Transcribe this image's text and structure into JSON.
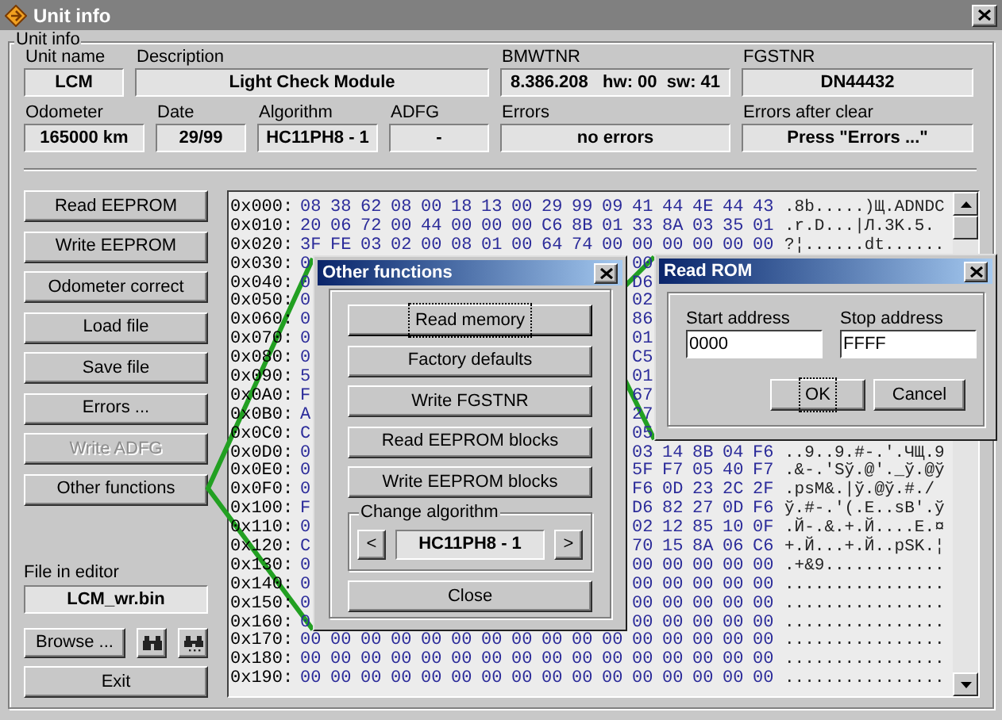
{
  "window": {
    "title": "Unit info"
  },
  "unit_info": {
    "title": "Unit info",
    "row_1": [
      {
        "label": "Unit name",
        "value": "LCM"
      },
      {
        "label": "Description",
        "value": "Light Check Module"
      },
      {
        "label": "BMWTNR",
        "value": "8.386.208   hw: 00  sw: 41"
      },
      {
        "label": "FGSTNR",
        "value": "DN44432"
      }
    ],
    "row_2": [
      {
        "label": "Odometer",
        "value": "165000 km"
      },
      {
        "label": "Date",
        "value": "29/99"
      },
      {
        "label": "Algorithm",
        "value": "HC11PH8 - 1"
      },
      {
        "label": "ADFG",
        "value": "-"
      },
      {
        "label": "Errors",
        "value": "no errors"
      },
      {
        "label": "Errors after clear",
        "value": "Press \"Errors ...\""
      }
    ]
  },
  "buttons": [
    {
      "label": "Read EEPROM",
      "disabled": false
    },
    {
      "label": "Write EEPROM",
      "disabled": false
    },
    {
      "label": "Odometer correct",
      "disabled": false
    },
    {
      "label": "Load file",
      "disabled": false
    },
    {
      "label": "Save file",
      "disabled": false
    },
    {
      "label": "Errors ...",
      "disabled": false
    },
    {
      "label": "Write ADFG",
      "disabled": true
    },
    {
      "label": "Other functions",
      "disabled": false
    }
  ],
  "file_in_editor": {
    "label": "File in editor",
    "value": "LCM_wr.bin"
  },
  "browse_button": "Browse ...",
  "exit_button": "Exit",
  "hex_view": {
    "rows": [
      {
        "kind": "full",
        "address": "0x000:",
        "bytes": [
          "08",
          "38",
          "62",
          "08",
          "00",
          "18",
          "13",
          "00",
          "29",
          "99",
          "09",
          "41",
          "44",
          "4E",
          "44",
          "43"
        ],
        "ascii": ".8b.....)Щ.ADNDC"
      },
      {
        "kind": "full",
        "address": "0x010:",
        "bytes": [
          "20",
          "06",
          "72",
          "00",
          "44",
          "00",
          "00",
          "00",
          "C6",
          "8B",
          "01",
          "33",
          "8A",
          "03",
          "35",
          "01"
        ],
        "ascii": ".r.D...|Л.3K.5."
      },
      {
        "kind": "full",
        "address": "0x020:",
        "bytes": [
          "3F",
          "FE",
          "03",
          "02",
          "00",
          "08",
          "01",
          "00",
          "64",
          "74",
          "00",
          "00",
          "00",
          "00",
          "00",
          "00"
        ],
        "ascii": "?¦......dt......"
      },
      {
        "kind": "covered",
        "address": "0x030:",
        "first": "0",
        "tail": [
          "00"
        ]
      },
      {
        "kind": "covered",
        "address": "0x040:",
        "first": "0",
        "tail": [
          "D6"
        ]
      },
      {
        "kind": "covered",
        "address": "0x050:",
        "first": "0",
        "tail": [
          "02"
        ]
      },
      {
        "kind": "covered",
        "address": "0x060:",
        "first": "0",
        "tail": [
          "86"
        ]
      },
      {
        "kind": "covered",
        "address": "0x070:",
        "first": "0",
        "tail": [
          "01"
        ]
      },
      {
        "kind": "covered",
        "address": "0x080:",
        "first": "0",
        "tail": [
          "C5"
        ]
      },
      {
        "kind": "covered",
        "address": "0x090:",
        "first": "5",
        "tail": [
          "01"
        ]
      },
      {
        "kind": "covered",
        "address": "0x0A0:",
        "first": "F",
        "tail": [
          "67"
        ]
      },
      {
        "kind": "covered",
        "address": "0x0B0:",
        "first": "A",
        "tail": [
          "27"
        ]
      },
      {
        "kind": "covered",
        "address": "0x0C0:",
        "first": "C",
        "tail": [
          "05"
        ]
      },
      {
        "kind": "covered",
        "address": "0x0D0:",
        "first": "0",
        "tail": [
          "03",
          "14",
          "8B",
          "04",
          "F6"
        ],
        "ascii": "..9..9.#-.'.ЧЩ.9"
      },
      {
        "kind": "covered",
        "address": "0x0E0:",
        "first": "0",
        "tail": [
          "5F",
          "F7",
          "05",
          "40",
          "F7"
        ],
        "ascii": ".&-.'Sў.@'._ў.@ў"
      },
      {
        "kind": "covered",
        "address": "0x0F0:",
        "first": "0",
        "tail": [
          "F6",
          "0D",
          "23",
          "2C",
          "2F"
        ],
        "ascii": ".psM&.|ў.@ў.#./"
      },
      {
        "kind": "covered",
        "address": "0x100:",
        "first": "F",
        "tail": [
          "D6",
          "82",
          "27",
          "0D",
          "F6"
        ],
        "ascii": "ў.#-.'(.E..sB'.ў"
      },
      {
        "kind": "covered",
        "address": "0x110:",
        "first": "0",
        "tail": [
          "02",
          "12",
          "85",
          "10",
          "0F"
        ],
        "ascii": ".Й-.&.+.Й....E.¤"
      },
      {
        "kind": "covered",
        "address": "0x120:",
        "first": "C",
        "tail": [
          "70",
          "15",
          "8A",
          "06",
          "C6"
        ],
        "ascii": "+.Й...+.Й..pSK.¦"
      },
      {
        "kind": "covered",
        "address": "0x130:",
        "first": "0",
        "tail": [
          "00",
          "00",
          "00",
          "00",
          "00"
        ],
        "ascii": ".+&9............"
      },
      {
        "kind": "covered",
        "address": "0x140:",
        "first": "0",
        "tail": [
          "00",
          "00",
          "00",
          "00",
          "00"
        ],
        "ascii": "................"
      },
      {
        "kind": "covered",
        "address": "0x150:",
        "first": "0",
        "tail": [
          "00",
          "00",
          "00",
          "00",
          "00"
        ],
        "ascii": "................"
      },
      {
        "kind": "covered",
        "address": "0x160:",
        "first": "0",
        "tail": [
          "00",
          "00",
          "00",
          "00",
          "00"
        ],
        "ascii": "................"
      },
      {
        "kind": "full",
        "address": "0x170:",
        "bytes": [
          "00",
          "00",
          "00",
          "00",
          "00",
          "00",
          "00",
          "00",
          "00",
          "00",
          "00",
          "00",
          "00",
          "00",
          "00",
          "00"
        ],
        "ascii": "................"
      },
      {
        "kind": "full",
        "address": "0x180:",
        "bytes": [
          "00",
          "00",
          "00",
          "00",
          "00",
          "00",
          "00",
          "00",
          "00",
          "00",
          "00",
          "00",
          "00",
          "00",
          "00",
          "00"
        ],
        "ascii": "................"
      },
      {
        "kind": "full",
        "address": "0x190:",
        "bytes": [
          "00",
          "00",
          "00",
          "00",
          "00",
          "00",
          "00",
          "00",
          "00",
          "00",
          "00",
          "00",
          "00",
          "00",
          "00",
          "00"
        ],
        "ascii": "................"
      }
    ]
  },
  "other_functions": {
    "title": "Other functions",
    "buttons": [
      {
        "label": "Read memory",
        "focused": true
      },
      {
        "label": "Factory defaults",
        "focused": false
      },
      {
        "label": "Write FGSTNR",
        "focused": false
      },
      {
        "label": "Read EEPROM blocks",
        "focused": false
      },
      {
        "label": "Write EEPROM blocks",
        "focused": false
      }
    ],
    "change_algorithm": {
      "label": "Change algorithm",
      "prev": "<",
      "value": "HC11PH8 - 1",
      "next": ">"
    },
    "close_button": "Close"
  },
  "read_rom": {
    "title": "Read ROM",
    "start_address": {
      "label": "Start address",
      "value": "0000"
    },
    "stop_address": {
      "label": "Stop address",
      "value": "FFFF"
    },
    "buttons": [
      {
        "label": "OK",
        "focused": true
      },
      {
        "label": "Cancel",
        "focused": false
      }
    ]
  }
}
